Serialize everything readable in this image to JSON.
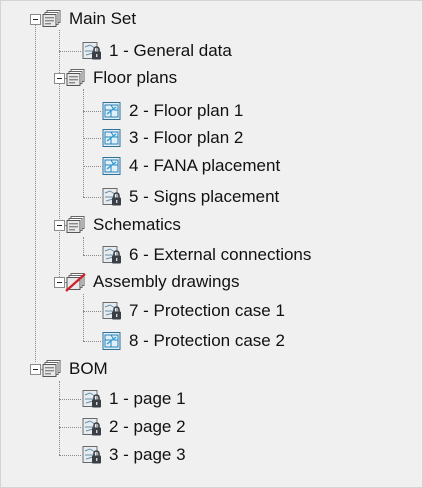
{
  "tree": {
    "main_set": {
      "label": "Main Set",
      "icon": "set-folder-icon"
    },
    "general_data": {
      "label": "1 - General data",
      "icon": "locked-sheet-icon"
    },
    "floor_plans": {
      "label": "Floor plans",
      "icon": "subset-folder-icon"
    },
    "floor_plan_1": {
      "label": "2 - Floor plan 1",
      "icon": "plan-sheet-icon"
    },
    "floor_plan_2": {
      "label": "3 - Floor plan 2",
      "icon": "plan-sheet-icon"
    },
    "fana_placement": {
      "label": "4 - FANA placement",
      "icon": "plan-sheet-icon"
    },
    "signs_placement": {
      "label": "5 - Signs placement",
      "icon": "locked-sheet-icon"
    },
    "schematics": {
      "label": "Schematics",
      "icon": "subset-folder-icon"
    },
    "external_connections": {
      "label": "6 - External connections",
      "icon": "locked-sheet-icon"
    },
    "assembly_drawings": {
      "label": "Assembly drawings",
      "icon": "excluded-subset-icon"
    },
    "protection_case_1": {
      "label": "7 - Protection case 1",
      "icon": "locked-sheet-icon"
    },
    "protection_case_2": {
      "label": "8 - Protection case 2",
      "icon": "plan-sheet-icon"
    },
    "bom": {
      "label": "BOM",
      "icon": "set-folder-icon"
    },
    "bom_page_1": {
      "label": "1 - page 1",
      "icon": "locked-sheet-icon"
    },
    "bom_page_2": {
      "label": "2 - page 2",
      "icon": "locked-sheet-icon"
    },
    "bom_page_3": {
      "label": "3 - page 3",
      "icon": "locked-sheet-icon"
    }
  },
  "colors": {
    "background": "#f0f0f0",
    "connector": "#8a8a8a",
    "excluded_mark": "#d0202a"
  }
}
